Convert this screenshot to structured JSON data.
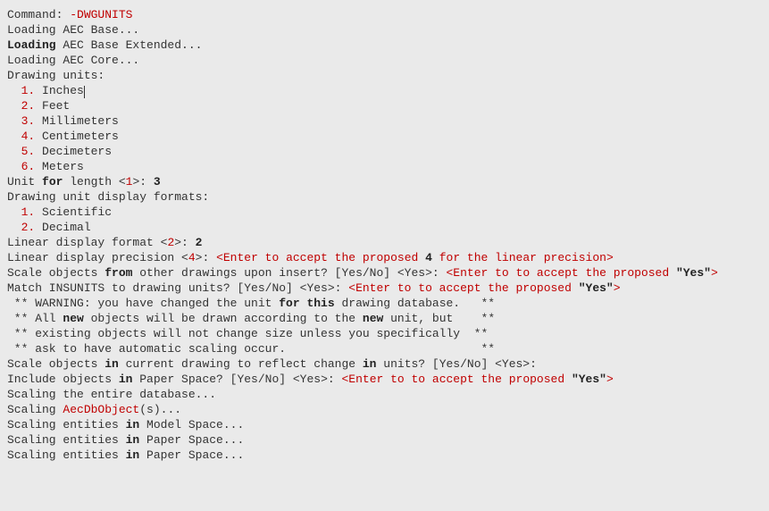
{
  "lines": {
    "cmd_label": "Command: ",
    "cmd_value": "-DWGUNITS",
    "load1": "Loading AEC Base...",
    "load_kw": "Loading",
    "load2_rest": " AEC Base Extended...",
    "load3": "Loading AEC Core...",
    "drawing_units": "Drawing units:",
    "n1": "1.",
    "u1": " Inches",
    "n2": "2.",
    "u2": " Feet",
    "n3": "3.",
    "u3": " Millimeters",
    "n4": "4.",
    "u4": " Centimeters",
    "n5": "5.",
    "u5": " Decimeters",
    "n6": "6.",
    "u6": " Meters",
    "unit_prefix": "Unit ",
    "for": "for",
    "unit_rest": " length <",
    "one": "1",
    "unit_close": ">: ",
    "three": "3",
    "formats": "Drawing unit display formats:",
    "f1n": "1.",
    "f1": " Scientific",
    "f2n": "2.",
    "f2": " Decimal",
    "ldf_prefix": "Linear display format <",
    "two": "2",
    "ldf_close": ">: ",
    "ldf_ans": "2",
    "ldp_prefix": "Linear display precision <",
    "four": "4",
    "ldp_close": ">: ",
    "ldp_hint_a": "<Enter to accept the proposed ",
    "ldp_hint_b": " for the linear precision>",
    "scale_other_a": "Scale objects ",
    "from": "from",
    "scale_other_b": " other drawings upon insert? [Yes/No] <Yes>: ",
    "hint_yes_a": "<Enter to to accept the proposed ",
    "yes_q": "\"Yes\"",
    "hint_yes_b": ">",
    "match_a": "Match INSUNITS to drawing units? [Yes/No] <Yes>: ",
    "warn1a": " ** WARNING: you have changed the unit ",
    "for_this": "for this",
    "warn1b": " drawing database.   **",
    "warn2a": " ** All ",
    "new": "new",
    "warn2b": " objects will be drawn according to the ",
    "warn2c": " unit, but    **",
    "warn3": " ** existing objects will not change size unless you specifically  **",
    "warn4": " ** ask to have automatic scaling occur.                            **",
    "scale_cur_a": "Scale objects ",
    "in": "in",
    "scale_cur_b": " current drawing to reflect change ",
    "scale_cur_c": " units? [Yes/No] <Yes>:",
    "include_a": "Include objects ",
    "include_b": " Paper Space? [Yes/No] <Yes>: ",
    "scaling_db": "Scaling the entire database...",
    "scaling_obj_a": "Scaling ",
    "aecdbobject": "AecDbObject",
    "scaling_obj_b": "(s)...",
    "se_a": "Scaling entities ",
    "se_model": " Model Space...",
    "se_paper": " Paper Space..."
  }
}
